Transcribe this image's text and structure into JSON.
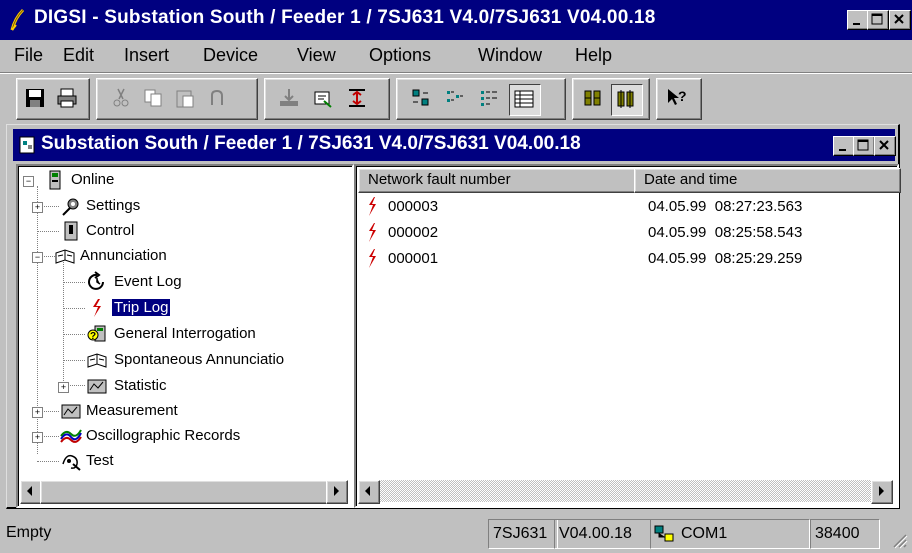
{
  "app": {
    "title": "DIGSI - Substation South / Feeder 1 / 7SJ631 V4.0/7SJ631 V04.00.18"
  },
  "menu": [
    {
      "label": "File"
    },
    {
      "label": "Edit"
    },
    {
      "label": "Insert"
    },
    {
      "label": "Device"
    },
    {
      "label": "View"
    },
    {
      "label": "Options"
    },
    {
      "label": "Window"
    },
    {
      "label": "Help"
    }
  ],
  "toolbar": {
    "buttons": [
      "save-icon",
      "print-icon",
      "cut-icon",
      "copy-icon",
      "paste-icon",
      "undo-icon",
      "export-icon",
      "properties-icon",
      "insert-icon",
      "large-icons-icon",
      "small-icons-icon",
      "list-icon",
      "details-icon",
      "sort-icon",
      "filter-icon",
      "help-pointer-icon"
    ]
  },
  "child_window": {
    "title": "Substation South / Feeder 1 / 7SJ631 V4.0/7SJ631 V04.00.18"
  },
  "tree": {
    "online": "Online",
    "settings": "Settings",
    "control": "Control",
    "annunciation": "Annunciation",
    "event_log": "Event Log",
    "trip_log": "Trip Log",
    "general_interrogation": "General Interrogation",
    "spontaneous": "Spontaneous Annunciatio",
    "statistic": "Statistic",
    "measurement": "Measurement",
    "oscillographic": "Oscillographic Records",
    "test": "Test"
  },
  "list": {
    "columns": [
      "Network fault number",
      "Date and time"
    ],
    "rows": [
      {
        "number": "000003",
        "datetime": "04.05.99  08:27:23.563"
      },
      {
        "number": "000002",
        "datetime": "04.05.99  08:25:58.543"
      },
      {
        "number": "000001",
        "datetime": "04.05.99  08:25:29.259"
      }
    ]
  },
  "status": {
    "message": "Empty",
    "device": "7SJ631",
    "version": "V04.00.18",
    "port": "COM1",
    "baud": "38400"
  },
  "colors": {
    "titlebar": "#000080",
    "face": "#c0c0c0",
    "fault_icon": "#cc0000"
  }
}
